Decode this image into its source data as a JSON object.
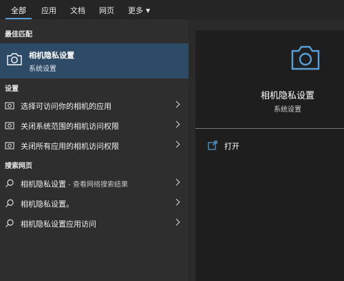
{
  "tabs": [
    {
      "label": "全部"
    },
    {
      "label": "应用"
    },
    {
      "label": "文档"
    },
    {
      "label": "网页"
    },
    {
      "label": "更多"
    }
  ],
  "best_match": {
    "section_title": "最佳匹配",
    "title": "相机隐私设置",
    "subtitle": "系统设置"
  },
  "settings": {
    "section_title": "设置",
    "items": [
      {
        "label": "选择可访问你的相机的应用"
      },
      {
        "label": "关闭系统范围的相机访问权限"
      },
      {
        "label": "关闭所有应用的相机访问权限"
      }
    ]
  },
  "web": {
    "section_title": "搜索网页",
    "items": [
      {
        "label": "相机隐私设置",
        "suffix": " - 查看网络搜索结果"
      },
      {
        "label": "相机隐私设置。",
        "suffix": ""
      },
      {
        "label": "相机隐私设置应用访问",
        "suffix": ""
      }
    ]
  },
  "preview": {
    "title": "相机隐私设置",
    "subtitle": "系统设置",
    "action_label": "打开"
  },
  "colors": {
    "accent": "#5aa0d8",
    "selected_bg": "#2d4a66"
  }
}
